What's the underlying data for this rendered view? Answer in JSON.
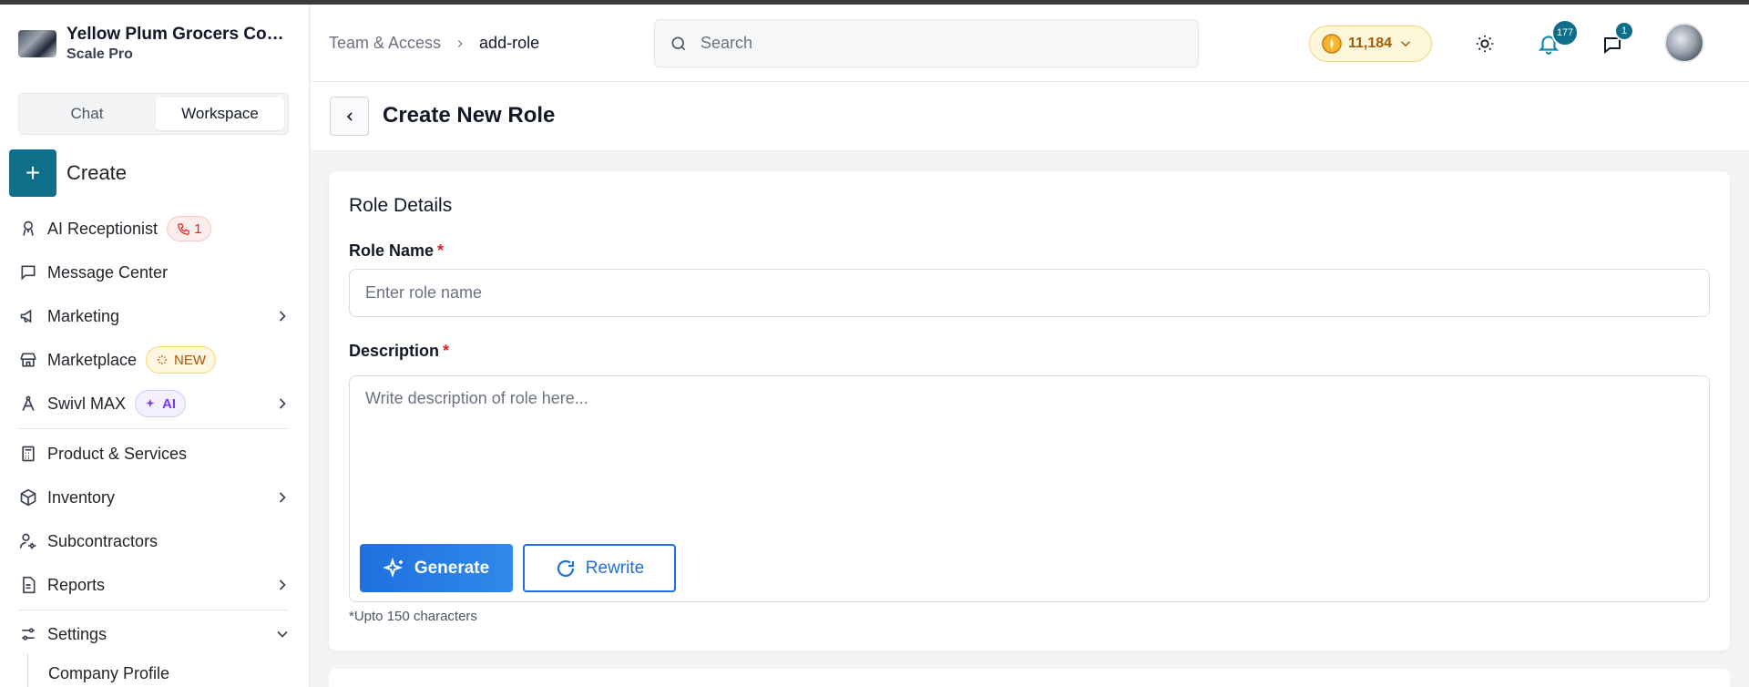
{
  "brand": {
    "name": "Yellow Plum Grocers Com...",
    "plan": "Scale Pro"
  },
  "mode_toggle": {
    "chat": "Chat",
    "workspace": "Workspace",
    "active": "Workspace"
  },
  "create_label": "Create",
  "nav": {
    "ai_receptionist": {
      "label": "AI Receptionist",
      "badge": "1"
    },
    "message_center": {
      "label": "Message Center"
    },
    "marketing": {
      "label": "Marketing"
    },
    "marketplace": {
      "label": "Marketplace",
      "badge": "NEW"
    },
    "swivl_max": {
      "label": "Swivl MAX",
      "badge": "AI"
    },
    "products": {
      "label": "Product & Services"
    },
    "inventory": {
      "label": "Inventory"
    },
    "subcontractors": {
      "label": "Subcontractors"
    },
    "reports": {
      "label": "Reports"
    },
    "settings": {
      "label": "Settings",
      "expanded": true,
      "sub_items": [
        "Company Profile"
      ]
    }
  },
  "breadcrumb": {
    "parent": "Team & Access",
    "current": "add-role"
  },
  "search": {
    "placeholder": "Search",
    "value": ""
  },
  "credits": {
    "value": "11,184"
  },
  "notifications": {
    "count": "177"
  },
  "messages": {
    "count": "1"
  },
  "page": {
    "title": "Create New Role"
  },
  "form": {
    "section_title": "Role Details",
    "role_name": {
      "label": "Role Name",
      "required_mark": "*",
      "placeholder": "Enter role name",
      "value": ""
    },
    "description": {
      "label": "Description",
      "required_mark": "*",
      "placeholder": "Write description of role here...",
      "value": ""
    },
    "generate_label": "Generate",
    "rewrite_label": "Rewrite",
    "hint": "*Upto 150 characters"
  },
  "colors": {
    "primary": "#0f6e8a",
    "accent_blue": "#1f6fe0",
    "required": "#dc2626",
    "credits_bg": "#fdf6d8"
  }
}
